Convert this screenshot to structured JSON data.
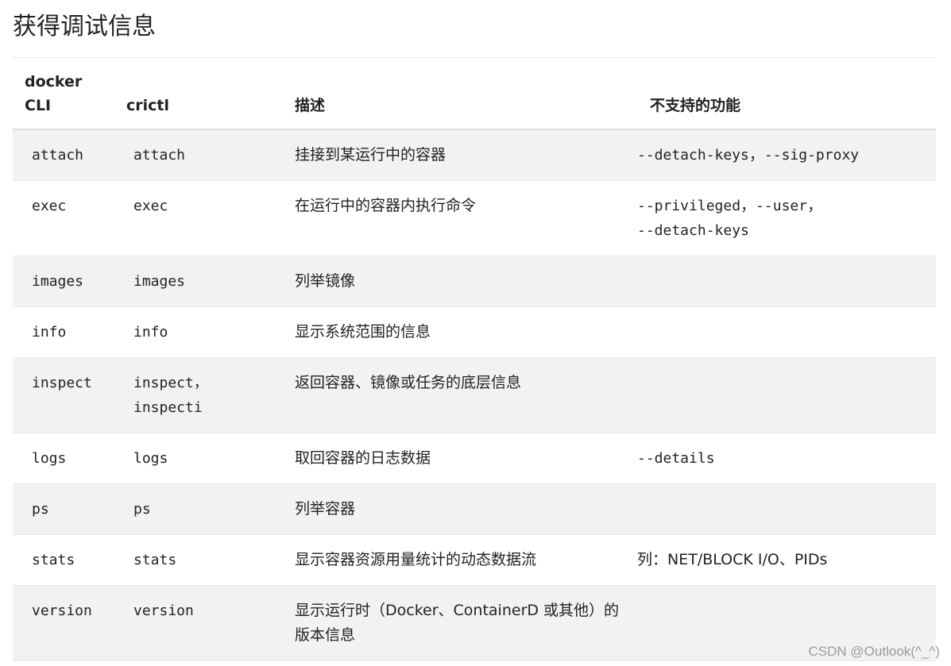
{
  "page": {
    "title": "获得调试信息"
  },
  "table": {
    "headers": {
      "docker_cli_line1": "docker",
      "docker_cli_line2": "CLI",
      "crictl": "crictl",
      "description": "描述",
      "unsupported": "不支持的功能"
    },
    "rows": [
      {
        "docker": "attach",
        "crictl": [
          "attach"
        ],
        "description": "挂接到某运行中的容器",
        "unsupported_code": [
          "--detach-keys",
          "--sig-proxy"
        ],
        "unsupported_text": ""
      },
      {
        "docker": "exec",
        "crictl": [
          "exec"
        ],
        "description": "在运行中的容器内执行命令",
        "unsupported_code": [
          "--privileged",
          "--user",
          "--detach-keys"
        ],
        "unsupported_text": ""
      },
      {
        "docker": "images",
        "crictl": [
          "images"
        ],
        "description": "列举镜像",
        "unsupported_code": [],
        "unsupported_text": ""
      },
      {
        "docker": "info",
        "crictl": [
          "info"
        ],
        "description": "显示系统范围的信息",
        "unsupported_code": [],
        "unsupported_text": ""
      },
      {
        "docker": "inspect",
        "crictl": [
          "inspect",
          "inspecti"
        ],
        "description": "返回容器、镜像或任务的底层信息",
        "unsupported_code": [],
        "unsupported_text": ""
      },
      {
        "docker": "logs",
        "crictl": [
          "logs"
        ],
        "description": "取回容器的日志数据",
        "unsupported_code": [
          "--details"
        ],
        "unsupported_text": ""
      },
      {
        "docker": "ps",
        "crictl": [
          "ps"
        ],
        "description": "列举容器",
        "unsupported_code": [],
        "unsupported_text": ""
      },
      {
        "docker": "stats",
        "crictl": [
          "stats"
        ],
        "description": "显示容器资源用量统计的动态数据流",
        "unsupported_code": [],
        "unsupported_text": "列：NET/BLOCK I/O、PIDs"
      },
      {
        "docker": "version",
        "crictl": [
          "version"
        ],
        "description_line1": "显示运行时（Docker、ContainerD 或其他）的",
        "description_line2": "版本信息",
        "unsupported_code": [],
        "unsupported_text": ""
      }
    ]
  },
  "separator": "，",
  "watermark": "CSDN @Outlook(^_^)"
}
